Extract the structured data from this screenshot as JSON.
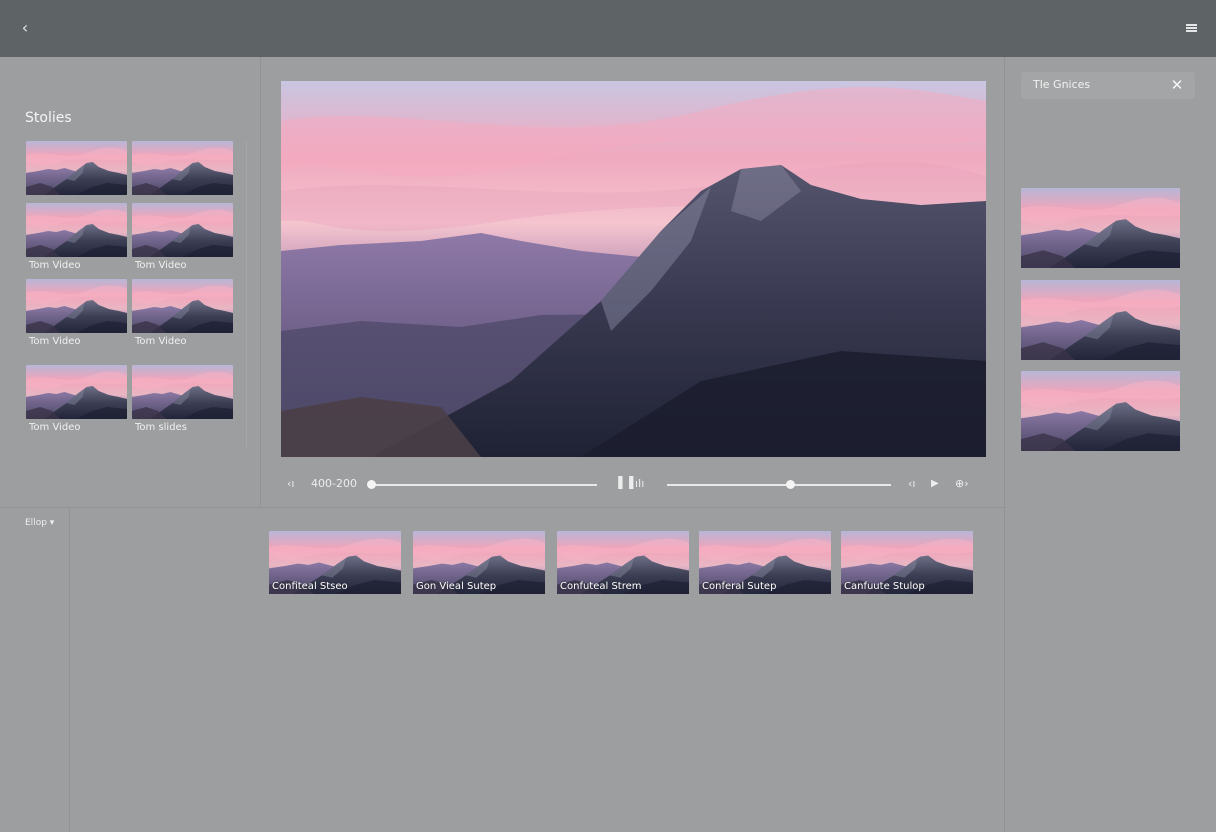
{
  "topbar": {
    "back_icon": "chevron-left-icon",
    "menu_icon": "menu-icon"
  },
  "sidebar": {
    "title": "Stolies",
    "items": [
      {
        "label": ""
      },
      {
        "label": ""
      },
      {
        "label": "Tom Video"
      },
      {
        "label": "Tom Video"
      },
      {
        "label": "Tom Video"
      },
      {
        "label": "Tom Video"
      },
      {
        "label": "Tom Video"
      },
      {
        "label": "Tom slides"
      }
    ]
  },
  "player": {
    "time": "400-200",
    "seek_progress": 0.0,
    "volume_level": 0.55,
    "icons": [
      "rewind-icon",
      "pause-icon",
      "captions-icon",
      "previous-icon",
      "play-icon",
      "fullscreen-icon"
    ]
  },
  "right_panel": {
    "title": "Tle Gnices",
    "close_icon": "close-icon",
    "thumb_count": 3
  },
  "filter": {
    "label": "Ellop"
  },
  "strip": {
    "items": [
      {
        "label": "Confiteal Stseo"
      },
      {
        "label": "Gon Vieal Sutep"
      },
      {
        "label": "Confuteal Strem"
      },
      {
        "label": "Conferal Sutep"
      },
      {
        "label": "Canfuute Stulop"
      }
    ]
  },
  "colors": {
    "topbar": "#5e6366",
    "background": "#9d9e9f",
    "accent": "#f4a7bb"
  }
}
